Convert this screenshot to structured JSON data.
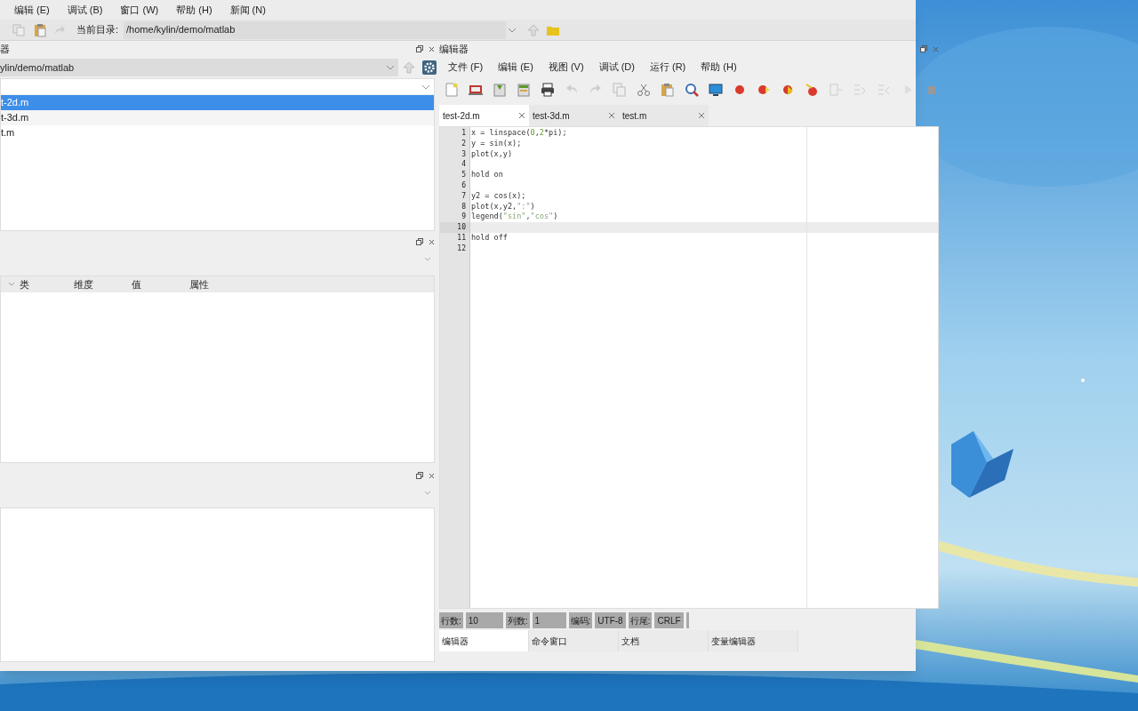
{
  "main_menu": [
    {
      "label": "编辑 (E)"
    },
    {
      "label": "调试 (B)"
    },
    {
      "label": "窗口 (W)"
    },
    {
      "label": "帮助 (H)"
    },
    {
      "label": "新闻 (N)"
    }
  ],
  "toolbar": {
    "current_dir_label": "当前目录:",
    "current_dir": "/home/kylin/demo/matlab"
  },
  "file_browser": {
    "title": "器",
    "path": "ylin/demo/matlab",
    "files": [
      {
        "name": "t-2d.m",
        "selected": true
      },
      {
        "name": "t-3d.m",
        "selected": false
      },
      {
        "name": "t.m",
        "selected": false
      }
    ]
  },
  "workspace": {
    "columns": [
      "类",
      "维度",
      "值",
      "属性"
    ]
  },
  "editor": {
    "title": "编辑器",
    "menu": [
      {
        "label": "文件 (F)"
      },
      {
        "label": "编辑 (E)"
      },
      {
        "label": "视图 (V)"
      },
      {
        "label": "调试 (D)"
      },
      {
        "label": "运行 (R)"
      },
      {
        "label": "帮助 (H)"
      }
    ],
    "tabs": [
      {
        "label": "test-2d.m",
        "selected": true
      },
      {
        "label": "test-3d.m",
        "selected": false
      },
      {
        "label": "test.m",
        "selected": false
      }
    ],
    "lines": [
      {
        "number": "1",
        "code": "x = linspace(0,2*pi);",
        "current": false
      },
      {
        "number": "2",
        "code": "y = sin(x);",
        "current": false
      },
      {
        "number": "3",
        "code": "plot(x,y)",
        "current": false
      },
      {
        "number": "4",
        "current": false
      },
      {
        "number": "5",
        "code": "hold on",
        "current": false
      },
      {
        "number": "6",
        "current": false
      },
      {
        "number": "7",
        "code": "y2 = cos(x);",
        "current": false
      },
      {
        "number": "8",
        "code": "plot(x,y2,\":\")",
        "current": false
      },
      {
        "number": "9",
        "code": "legend(\"sin\",\"cos\")",
        "current": false
      },
      {
        "number": "10",
        "current": true
      },
      {
        "number": "11",
        "code": "hold off",
        "current": false
      },
      {
        "number": "12",
        "current": false
      }
    ],
    "status": [
      {
        "label": "行数:",
        "value": "10"
      },
      {
        "label": "列数:",
        "value": "1"
      },
      {
        "label": "编码:",
        "value": "UTF-8"
      },
      {
        "label": "行尾:",
        "value": "CRLF"
      }
    ],
    "bottom_tabs": [
      {
        "label": "编辑器",
        "selected": true
      },
      {
        "label": "命令窗口",
        "selected": false
      },
      {
        "label": "文档",
        "selected": false
      },
      {
        "label": "变量编辑器",
        "selected": false
      }
    ]
  }
}
